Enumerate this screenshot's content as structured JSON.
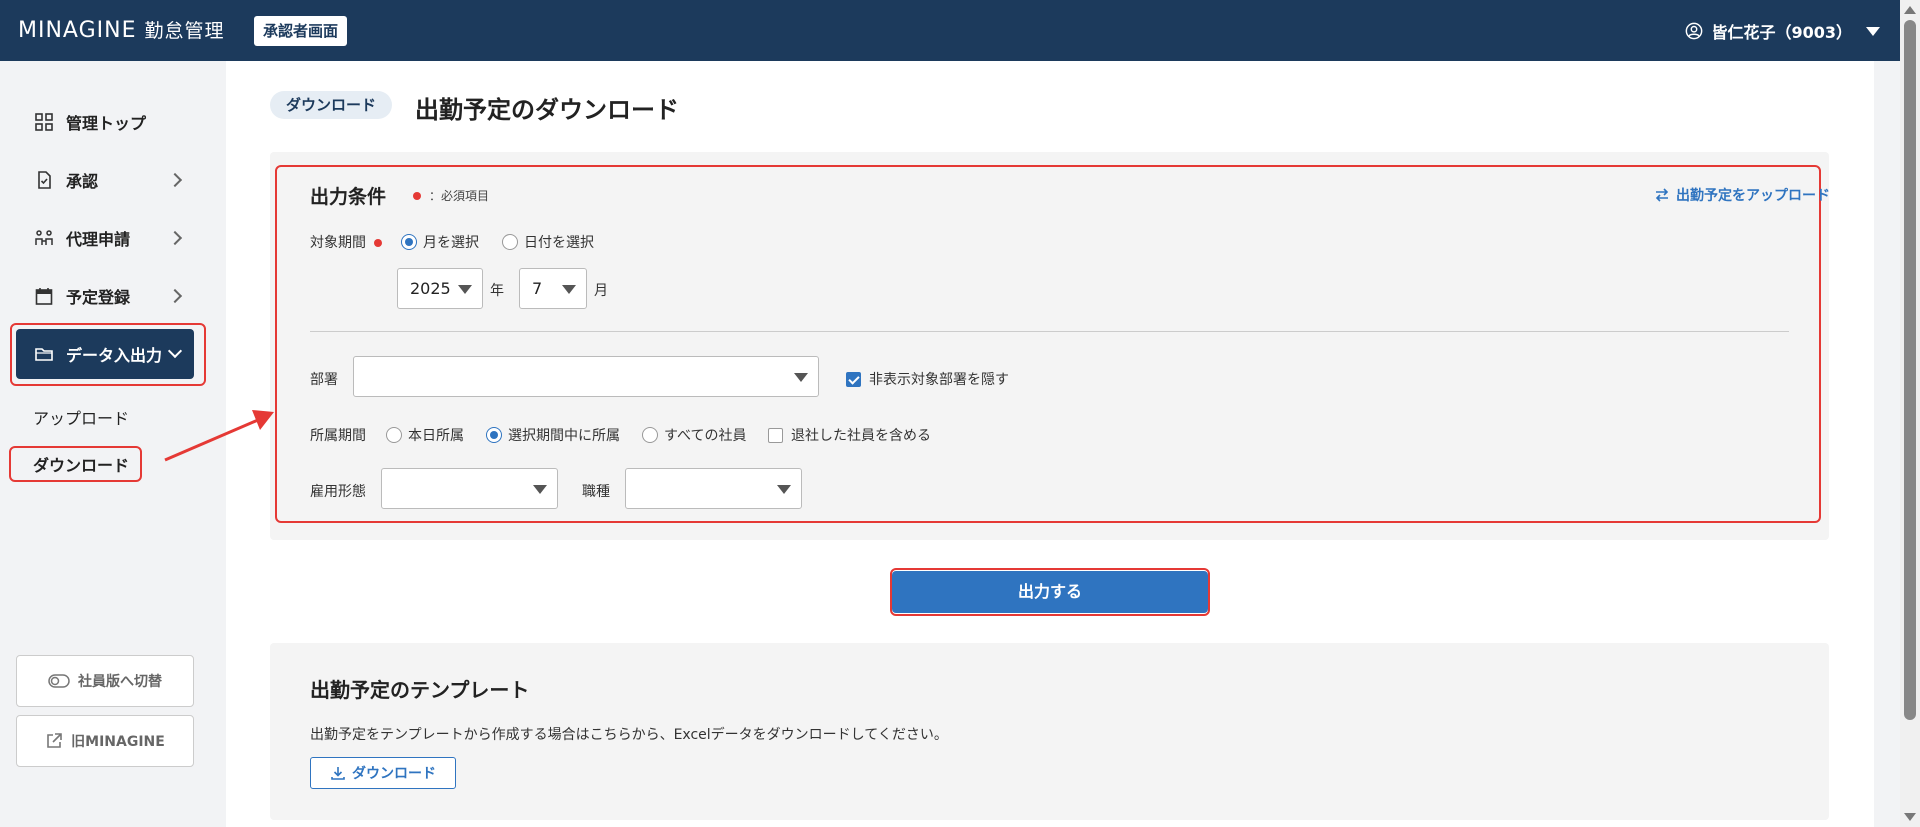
{
  "header": {
    "brand_en": "MINAGINE",
    "brand_jp": "勤怠管理",
    "role_badge": "承認者画面",
    "user_name": "皆仁花子（9003）"
  },
  "sidebar": {
    "items": [
      {
        "label": "管理トップ",
        "icon": "grid-icon"
      },
      {
        "label": "承認",
        "icon": "document-check-icon"
      },
      {
        "label": "代理申請",
        "icon": "people-icon"
      },
      {
        "label": "予定登録",
        "icon": "calendar-icon"
      },
      {
        "label": "データ入出力",
        "icon": "folder-icon"
      }
    ],
    "sub_items": [
      {
        "label": "アップロード"
      },
      {
        "label": "ダウンロード"
      }
    ],
    "switch_label": "社員版へ切替",
    "old_label": "旧MINAGINE"
  },
  "page": {
    "crumb": "ダウンロード",
    "title": "出勤予定のダウンロード"
  },
  "conditions": {
    "title": "出力条件",
    "required_note": "：必須項目",
    "upload_link": "出勤予定をアップロード",
    "period_label": "対象期間",
    "period_options": [
      "月を選択",
      "日付を選択"
    ],
    "year_value": "2025",
    "year_unit": "年",
    "month_value": "7",
    "month_unit": "月",
    "dept_label": "部署",
    "dept_value": "",
    "hide_dept_label": "非表示対象部署を隠す",
    "affil_label": "所属期間",
    "affil_options": [
      "本日所属",
      "選択期間中に所属",
      "すべての社員"
    ],
    "retired_label": "退社した社員を含める",
    "emp_type_label": "雇用形態",
    "job_label": "職種"
  },
  "actions": {
    "output_label": "出力する"
  },
  "template": {
    "title": "出勤予定のテンプレート",
    "desc": "出勤予定をテンプレートから作成する場合はこちらから、Excelデータをダウンロードしてください。",
    "download_label": "ダウンロード"
  },
  "colors": {
    "header": "#1c3a5c",
    "accent": "#2f74c0",
    "highlight": "#e53935"
  }
}
